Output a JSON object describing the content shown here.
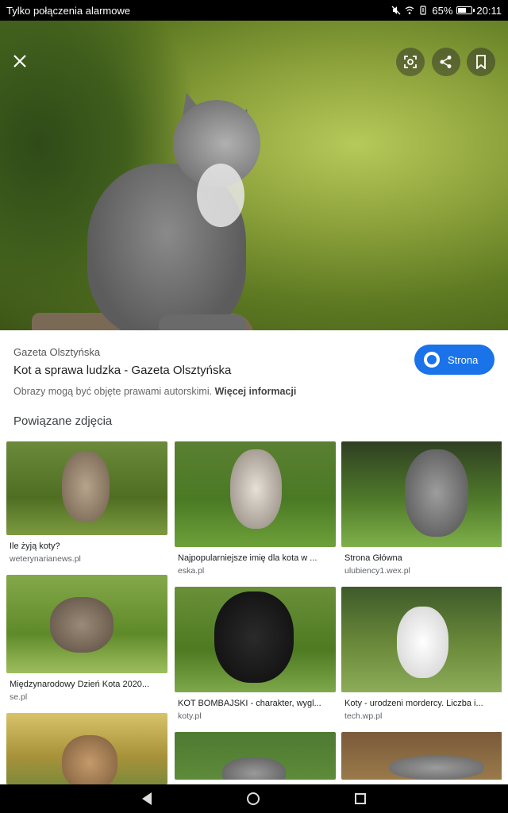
{
  "status_bar": {
    "left_text": "Tylko połączenia alarmowe",
    "battery": "65%",
    "battery_level": 0.65,
    "time": "20:11"
  },
  "hero": {
    "close_icon": "close-icon",
    "actions": [
      "lens-icon",
      "share-icon",
      "bookmark-icon"
    ]
  },
  "info": {
    "source": "Gazeta Olsztyńska",
    "title": "Kot a sprawa ludzka - Gazeta Olsztyńska",
    "copyright_text": "Obrazy mogą być objęte prawami autorskimi.",
    "more_info": "Więcej informacji",
    "visit_label": "Strona",
    "visit_color": "#1a73e8"
  },
  "related": {
    "heading": "Powiązane zdjęcia",
    "columns": [
      [
        {
          "title": "Ile żyją koty?",
          "domain": "weterynarianews.pl"
        },
        {
          "title": "Międzynarodowy Dzień Kota 2020...",
          "domain": "se.pl"
        },
        {
          "title": "",
          "domain": ""
        }
      ],
      [
        {
          "title": "Najpopularniejsze imię dla kota w ...",
          "domain": "eska.pl"
        },
        {
          "title": "KOT BOMBAJSKI - charakter, wygl...",
          "domain": "koty.pl"
        },
        {
          "title": "",
          "domain": ""
        }
      ],
      [
        {
          "title": "Strona Główna",
          "domain": "ulubiency1.wex.pl"
        },
        {
          "title": "Koty - urodzeni mordercy. Liczba i...",
          "domain": "tech.wp.pl"
        },
        {
          "title": "",
          "domain": ""
        }
      ]
    ]
  },
  "nav": {
    "back": "back-icon",
    "home": "home-icon",
    "recents": "recents-icon"
  }
}
